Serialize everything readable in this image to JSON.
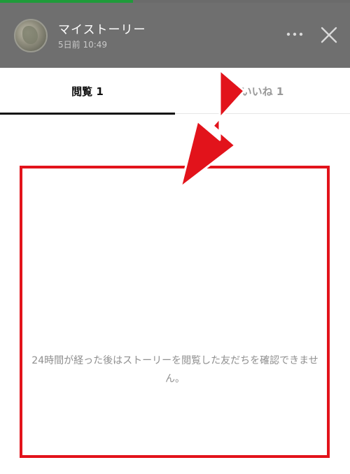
{
  "progress": {
    "fraction": 0.38,
    "color": "#1f9b3a"
  },
  "header": {
    "title": "マイストーリー",
    "subtitle": "5日前 10:49",
    "background": "#6f6f6f",
    "more_icon": "more-dots-icon",
    "close_icon": "close-icon"
  },
  "tabs": [
    {
      "label": "閲覧 1",
      "active": true
    },
    {
      "label": "いいね 1",
      "active": false
    }
  ],
  "empty_state": {
    "message": "24時間が経った後はストーリーを閲覧した友だちを確認できません。"
  },
  "annotation": {
    "color": "#e2131b",
    "arrow_icon": "red-arrow-icon"
  }
}
